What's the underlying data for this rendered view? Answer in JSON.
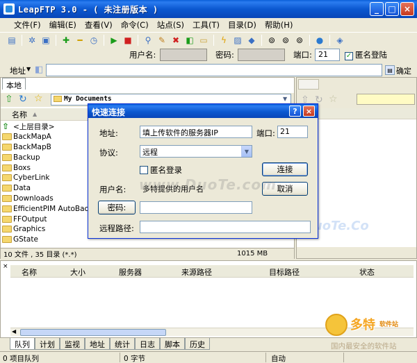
{
  "window": {
    "title": "LeapFTP 3.0 - ( 未注册版本 )",
    "min_label": "_",
    "max_label": "□",
    "close_label": "×"
  },
  "menu": [
    "文件(F)",
    "编辑(E)",
    "查看(V)",
    "命令(C)",
    "站点(S)",
    "工具(T)",
    "目录(D)",
    "帮助(H)"
  ],
  "connection": {
    "user_label": "用户名:",
    "user_value": "",
    "password_label": "密码:",
    "password_value": "",
    "port_label": "端口:",
    "port_value": "21",
    "anonymous_label": "匿名登陆",
    "anonymous_checked": true
  },
  "address": {
    "label": "地址",
    "value": "",
    "go_label": "确定"
  },
  "left_panel": {
    "tab": "本地",
    "path": "My Documents",
    "column_name": "名称",
    "files": [
      {
        "name": "<上层目录>",
        "kind": "up"
      },
      {
        "name": "BackMapA",
        "kind": "folder"
      },
      {
        "name": "BackMapB",
        "kind": "folder"
      },
      {
        "name": "Backup",
        "kind": "folder"
      },
      {
        "name": "Boxs",
        "kind": "folder"
      },
      {
        "name": "CyberLink",
        "kind": "folder"
      },
      {
        "name": "Data",
        "kind": "folder"
      },
      {
        "name": "Downloads",
        "kind": "folder"
      },
      {
        "name": "EfficientPIM AutoBackup",
        "kind": "folder"
      },
      {
        "name": "FFOutput",
        "kind": "folder"
      },
      {
        "name": "Graphics",
        "kind": "folder"
      },
      {
        "name": "GState",
        "kind": "folder"
      }
    ],
    "status_count": "10 文件 , 35 目录 (*.*)",
    "status_size": "1015 MB"
  },
  "queue": {
    "columns": [
      "名称",
      "大小",
      "服务器",
      "来源路径",
      "目标路径",
      "状态"
    ]
  },
  "bottom_tabs": [
    "队列",
    "计划",
    "监视",
    "地址",
    "统计",
    "日志",
    "脚本",
    "历史"
  ],
  "status_bar": {
    "queue": "0 项目队列",
    "bytes": "0 字节",
    "mode": "自动"
  },
  "dialog": {
    "title": "快速连接",
    "help_label": "?",
    "close_label": "×",
    "address_label": "地址:",
    "address_value": "填上传软件的服务器IP",
    "port_label": "端口:",
    "port_value": "21",
    "protocol_label": "协议:",
    "protocol_value": "远程",
    "anonymous_label": "匿名登录",
    "anonymous_checked": false,
    "connect_label": "连接",
    "cancel_label": "取消",
    "user_label": "用户名:",
    "user_value": "多特提供的用户名",
    "password_label": "密码:",
    "password_value": "",
    "remote_path_label": "远程路径:",
    "remote_path_value": ""
  },
  "watermarks": {
    "center": "www.DuoTe.com",
    "right": "DuoTe.Co",
    "brand": "多特",
    "brand_sub": "软件站",
    "slogan": "国内最安全的软件站"
  }
}
